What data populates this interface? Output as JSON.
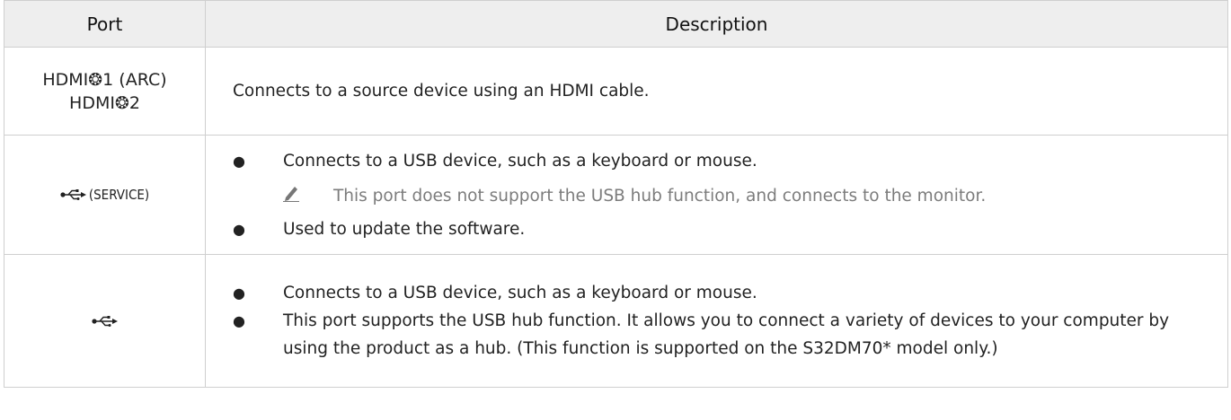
{
  "headers": {
    "port": "Port",
    "description": "Description"
  },
  "rows": [
    {
      "port_lines": [
        "HDMI❂1 (ARC)",
        "HDMI❂2"
      ],
      "description": "Connects to a source device using an HDMI cable."
    },
    {
      "port_icon": "usb-icon",
      "port_label": "(SERVICE)",
      "bullets": [
        "Connects to a USB device, such as a keyboard or mouse.",
        "Used to update the software."
      ],
      "note": "This port does not support the USB hub function, and connects to the monitor."
    },
    {
      "port_icon": "usb-icon",
      "bullets": [
        "Connects to a USB device, such as a keyboard or mouse.",
        "This port supports the USB hub function. It allows you to connect a variety of devices to your computer by using the product as a hub. (This function is supported on the S32DM70* model only.)"
      ]
    }
  ],
  "colors": {
    "header_bg": "#eeeeee",
    "border": "#cfcfcf",
    "note_text": "#7c7c7c"
  }
}
